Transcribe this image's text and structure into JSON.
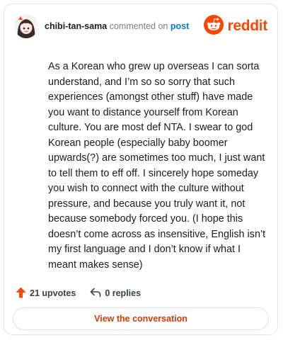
{
  "header": {
    "username": "chibi-tan-sama",
    "commented_on": "commented on",
    "post_link": "post",
    "brand": "reddit"
  },
  "comment": {
    "text": "As a Korean who grew up overseas I can sorta understand, and I’m so so sorry that such experiences (amongst other stuff) have made you want to distance yourself from Korean culture. You are most def NTA. I swear to god Korean people (especially baby boomer upwards(?) are sometimes too much, I just want to tell them to eff off. I sincerely hope someday you wish to connect with the culture without pressure, and because you truly want it, not because somebody forced you. (I hope this doesn’t come across as insensitive, English isn’t my first language and I don’t know if what I meant makes sense)"
  },
  "actions": {
    "upvotes": "21 upvotes",
    "replies": "0 replies"
  },
  "footer": {
    "view_conversation": "View the conversation"
  },
  "icons": {
    "upvote": "upvote-arrow-icon",
    "reply": "reply-arrow-icon",
    "brand_logo": "reddit-snoo-icon"
  },
  "colors": {
    "brand": "#ff4500",
    "upvote": "#ff4500",
    "link": "#0079d3",
    "view_button_text": "#d93a00"
  }
}
